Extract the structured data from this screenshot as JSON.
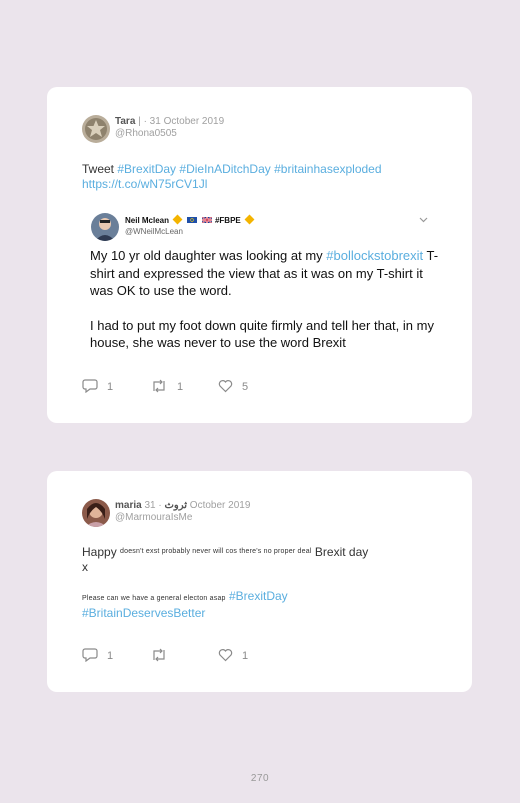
{
  "tweets": [
    {
      "name": "Tara",
      "separator": "|",
      "date": "· 31 October 2019",
      "handle": "@Rhona0505",
      "text_prefix": "Tweet",
      "hashtags": [
        "#BrexitDay",
        "#DieInADitchDay",
        "#britainhasexploded"
      ],
      "link": "https://t.co/wN75rCV1Jl",
      "quoted": {
        "name": "Neil Mclean",
        "hashtag": "#FBPE",
        "handle": "@WNeilMcLean",
        "para1_a": "My 10 yr old daughter was looking at my",
        "para1_tag": "#bollockstobrexit",
        "para1_b": "T-shirt and expressed the view that as it was on my T-shirt it was OK to use the word.",
        "para2": "I had to put my foot down quite firmly and tell her that, in my house, she was never to use the word Brexit"
      },
      "replies": "1",
      "retweets": "1",
      "likes": "5"
    },
    {
      "name": "maria",
      "name_arabic": "ثروث",
      "date": "· 31 October 2019",
      "handle": "@MarmouraIsMe",
      "line1_a": "Happy",
      "line1_small": "doesn't exst probably never will cos there's no proper deal",
      "line1_b": "Brexit day",
      "line1_c": "x",
      "line2_small": "Please can we have a general electon asap",
      "line2_tag1": "#BrexitDay",
      "line2_tag2": "#BritainDeservesBetter",
      "replies": "1",
      "retweets": "",
      "likes": "1"
    }
  ],
  "page_number": "270",
  "colors": {
    "background": "#ebe4ec",
    "card": "#ffffff",
    "hashtag": "#5aaedf",
    "meta": "#a0a0a0"
  },
  "icons": [
    "reply-icon",
    "retweet-icon",
    "like-icon",
    "chevron-down-icon"
  ]
}
